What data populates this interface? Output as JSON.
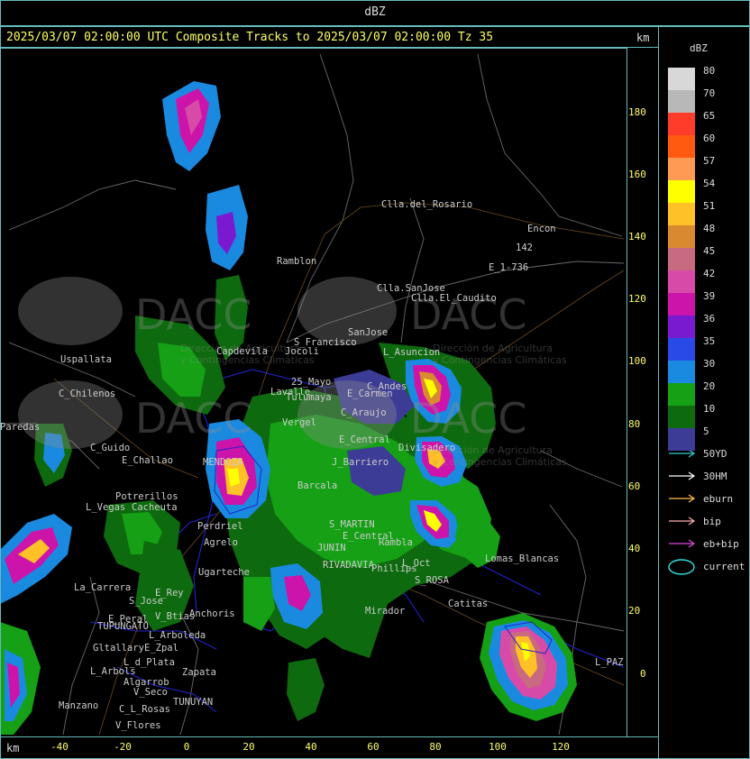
{
  "product_title": "dBZ",
  "header_text": "2025/03/07 02:00:00 UTC Composite Tracks to 2025/03/07 02:00:00 Tz 35",
  "km_label": "km",
  "y_axis_ticks": [
    "180",
    "160",
    "140",
    "120",
    "100",
    "80",
    "60",
    "40",
    "20",
    "0"
  ],
  "x_axis_ticks": [
    "-40",
    "-20",
    "0",
    "20",
    "40",
    "60",
    "80",
    "100",
    "120"
  ],
  "legend": {
    "title": "dBZ",
    "levels": [
      {
        "label": "80",
        "color": "#d8d8d8"
      },
      {
        "label": "70",
        "color": "#b8b8b8"
      },
      {
        "label": "65",
        "color": "#ff3b2a"
      },
      {
        "label": "60",
        "color": "#ff5a10"
      },
      {
        "label": "57",
        "color": "#ff9a55"
      },
      {
        "label": "54",
        "color": "#ffff00"
      },
      {
        "label": "51",
        "color": "#ffc028"
      },
      {
        "label": "48",
        "color": "#d98a30"
      },
      {
        "label": "45",
        "color": "#c86a80"
      },
      {
        "label": "42",
        "color": "#d84aa8"
      },
      {
        "label": "39",
        "color": "#cc14aa"
      },
      {
        "label": "36",
        "color": "#7a1ad0"
      },
      {
        "label": "35",
        "color": "#2a4ae8"
      },
      {
        "label": "30",
        "color": "#1a8ae0"
      },
      {
        "label": "20",
        "color": "#15a015"
      },
      {
        "label": "10",
        "color": "#0e6a0e"
      },
      {
        "label": "5",
        "color": "#3c3c96"
      }
    ]
  },
  "tracks": [
    {
      "label": "50YD",
      "color": "#33cccc",
      "icon": "arrow-icon"
    },
    {
      "label": "30HM",
      "color": "#ffffff",
      "icon": "arrow-icon"
    },
    {
      "label": "eburn",
      "color": "#ffbb55",
      "icon": "arrow-icon"
    },
    {
      "label": "bip",
      "color": "#ffb0b0",
      "icon": "arrow-icon"
    },
    {
      "label": "eb+bip",
      "color": "#dd44dd",
      "icon": "arrow-icon"
    },
    {
      "label": "current",
      "color": "#33e0e0",
      "icon": "ellipse-icon"
    }
  ],
  "watermark": {
    "text": "DACC",
    "subtitle_1": "Dirección de Agricultura",
    "subtitle_2": "y Contingencias Climáticas"
  },
  "places": [
    {
      "name": "Clla.del_Rosario"
    },
    {
      "name": "Encon"
    },
    {
      "name": "E_1-736"
    },
    {
      "name": "142"
    },
    {
      "name": "Ramblon"
    },
    {
      "name": "Clla.SanJose"
    },
    {
      "name": "Clla.El_Caudito"
    },
    {
      "name": "Uspallata"
    },
    {
      "name": "C_Chilenos"
    },
    {
      "name": "Paredas"
    },
    {
      "name": "C_Guido"
    },
    {
      "name": "E_Challao"
    },
    {
      "name": "Potrerillos"
    },
    {
      "name": "L_Vegas"
    },
    {
      "name": "Cacheuta"
    },
    {
      "name": "S_Francisco"
    },
    {
      "name": "Jocoli"
    },
    {
      "name": "Capdevila"
    },
    {
      "name": "Lavalle"
    },
    {
      "name": "SanJose"
    },
    {
      "name": "L_Asuncion"
    },
    {
      "name": "C_Andes"
    },
    {
      "name": "25_Mayo"
    },
    {
      "name": "Tulumaya"
    },
    {
      "name": "E_Carmen"
    },
    {
      "name": "C_Araujo"
    },
    {
      "name": "E_Central"
    },
    {
      "name": "Divisadero"
    },
    {
      "name": "J_Barriero"
    },
    {
      "name": "MENDOZA"
    },
    {
      "name": "Perdriel"
    },
    {
      "name": "Agrelo"
    },
    {
      "name": "Ugarteche"
    },
    {
      "name": "S_MARTIN"
    },
    {
      "name": "Rambla"
    },
    {
      "name": "E_Central"
    },
    {
      "name": "JUNIN"
    },
    {
      "name": "RIVADAVIA"
    },
    {
      "name": "Phillips"
    },
    {
      "name": "Lomas_Blancas"
    },
    {
      "name": "L_Oct"
    },
    {
      "name": "S_ROSA"
    },
    {
      "name": "Catitas"
    },
    {
      "name": "Mirador"
    },
    {
      "name": "La_Carrera"
    },
    {
      "name": "S_Jose"
    },
    {
      "name": "E_Rey"
    },
    {
      "name": "E_Peral"
    },
    {
      "name": "TUPUNGATO"
    },
    {
      "name": "V_Btias"
    },
    {
      "name": "Anchoris"
    },
    {
      "name": "L_Arboleda"
    },
    {
      "name": "Gltallary"
    },
    {
      "name": "E_Zpal"
    },
    {
      "name": "L_d_Plata"
    },
    {
      "name": "L_Arbols"
    },
    {
      "name": "Zapata"
    },
    {
      "name": "Algarrob"
    },
    {
      "name": "V_Seco"
    },
    {
      "name": "TUNUYAN"
    },
    {
      "name": "C_L_Rosas"
    },
    {
      "name": "Manzano"
    },
    {
      "name": "V_Flores"
    },
    {
      "name": "L_PAZ"
    },
    {
      "name": "Barcala"
    },
    {
      "name": "Vergel"
    }
  ]
}
